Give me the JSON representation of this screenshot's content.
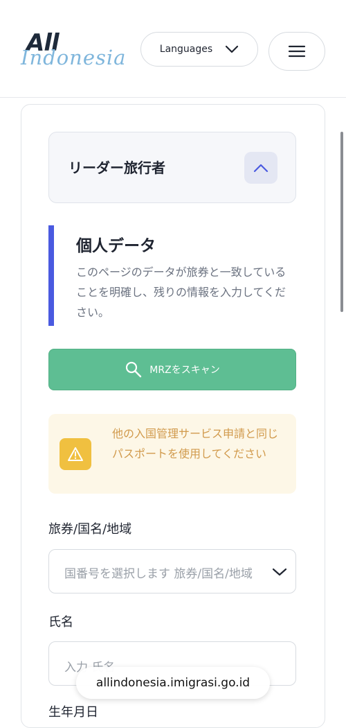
{
  "header": {
    "logo_top": "All",
    "logo_bottom": "Indonesia",
    "language_button": "Languages"
  },
  "accordion": {
    "title": "リーダー旅行者"
  },
  "section": {
    "title": "個人データ",
    "description": "このページのデータが旅券と一致していることを明確し、残りの情報を入力してください。"
  },
  "scan_button": {
    "label": "MRZをスキャン"
  },
  "warning": {
    "text": "他の入国管理サービス申請と同じパスポートを使用してください"
  },
  "fields": {
    "passport_country_label": "旅券/国名/地域",
    "passport_country_placeholder": "国番号を選択します 旅券/国名/地域",
    "name_label": "氏名",
    "name_placeholder": "入力 氏名",
    "next_label": "生年月日"
  },
  "browser": {
    "url": "allindonesia.imigrasi.go.id"
  },
  "colors": {
    "accent_bar": "#4a5ae0",
    "scan_button": "#5ebe93",
    "warning_bg": "#fdf7e7",
    "warning_text": "#d19a4c",
    "warning_icon": "#f0c040"
  }
}
